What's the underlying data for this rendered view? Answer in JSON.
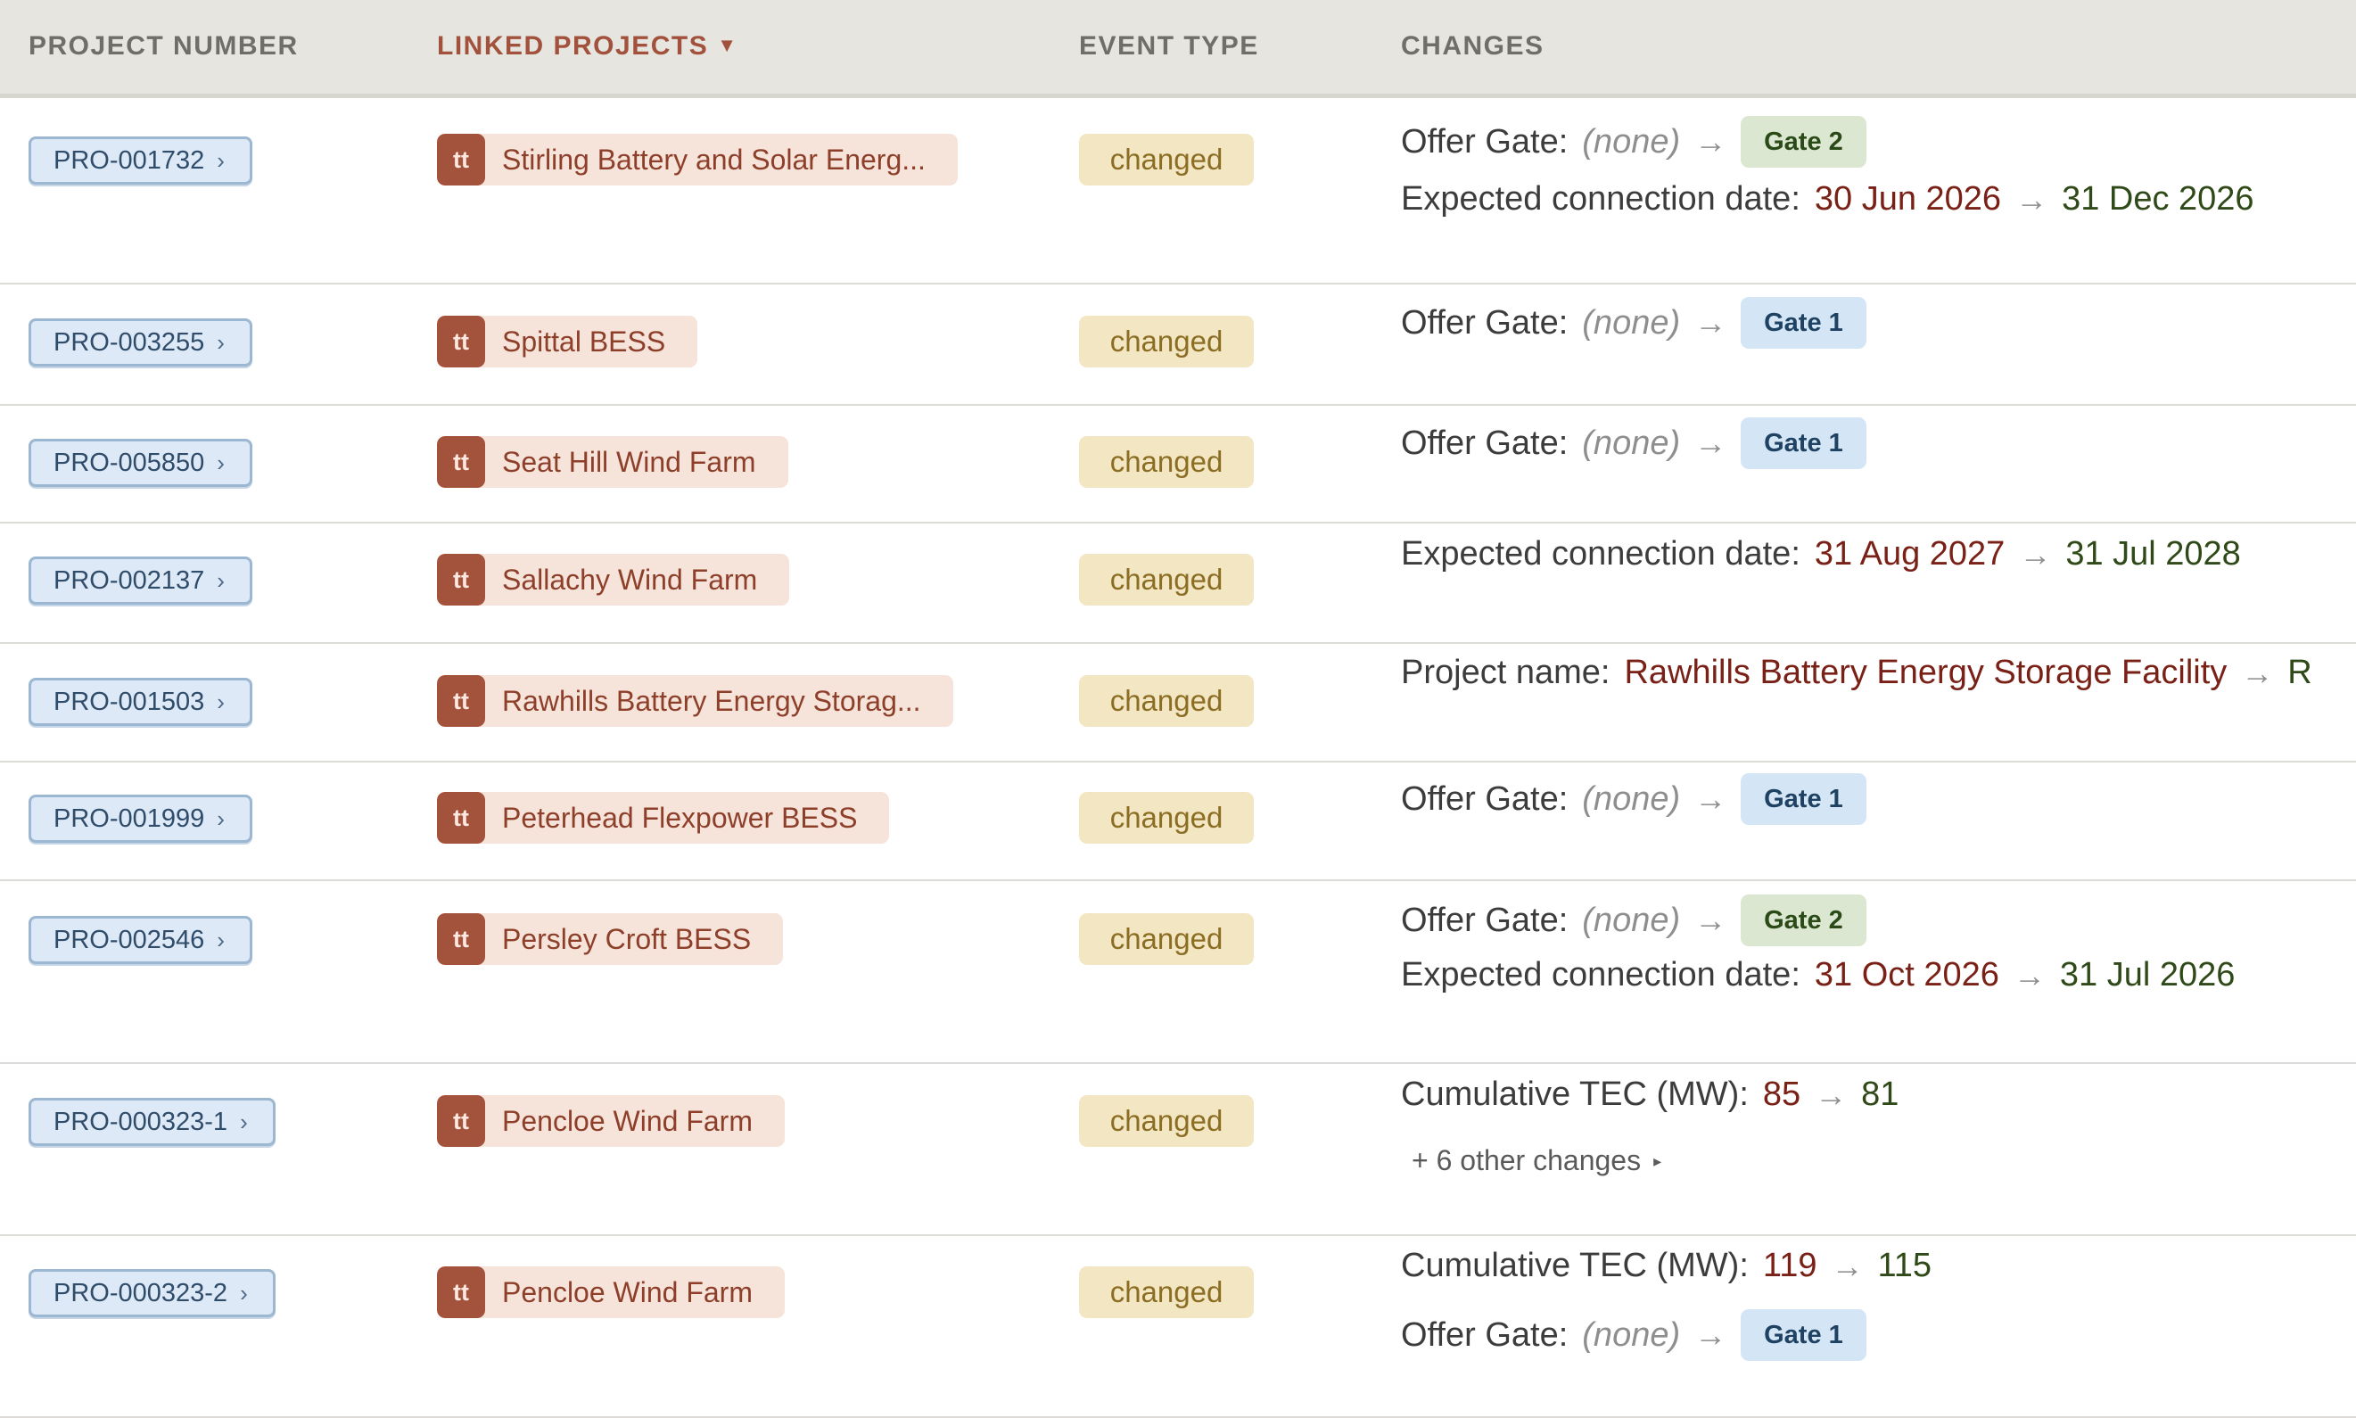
{
  "header": {
    "project_number": "PROJECT NUMBER",
    "linked_projects": "LINKED PROJECTS",
    "event_type": "EVENT TYPE",
    "changes": "CHANGES",
    "sort_indicator": "▼"
  },
  "icons": {
    "project_chevron": "chevron-right-icon",
    "arrow": "arrow-right-icon",
    "expand": "triangle-right-icon"
  },
  "colors": {
    "accent": "#a3523b",
    "gate1": "#d4e6f5",
    "gate2": "#dbe7d0",
    "event": "#f3e6c2",
    "project_pill": "#dde9f6"
  },
  "rows": [
    {
      "project_number": "PRO-001732",
      "avatar": "tt",
      "linked_project": "Stirling Battery and Solar Energ...",
      "event": "changed",
      "changes": [
        {
          "label": "Offer Gate:",
          "old": "(none)",
          "new": "Gate 2"
        },
        {
          "label": "Expected connection date:",
          "old": "30 Jun 2026",
          "new": "31 Dec 2026"
        }
      ]
    },
    {
      "project_number": "PRO-003255",
      "avatar": "tt",
      "linked_project": "Spittal BESS",
      "event": "changed",
      "changes": [
        {
          "label": "Offer Gate:",
          "old": "(none)",
          "new": "Gate 1"
        }
      ]
    },
    {
      "project_number": "PRO-005850",
      "avatar": "tt",
      "linked_project": "Seat Hill Wind Farm",
      "event": "changed",
      "changes": [
        {
          "label": "Offer Gate:",
          "old": "(none)",
          "new": "Gate 1"
        }
      ]
    },
    {
      "project_number": "PRO-002137",
      "avatar": "tt",
      "linked_project": "Sallachy Wind Farm",
      "event": "changed",
      "changes": [
        {
          "label": "Expected connection date:",
          "old": "31 Aug 2027",
          "new": "31 Jul 2028"
        }
      ]
    },
    {
      "project_number": "PRO-001503",
      "avatar": "tt",
      "linked_project": "Rawhills Battery Energy Storag...",
      "event": "changed",
      "changes": [
        {
          "label": "Project name:",
          "old": "Rawhills Battery Energy Storage Facility",
          "new": "R"
        }
      ]
    },
    {
      "project_number": "PRO-001999",
      "avatar": "tt",
      "linked_project": "Peterhead Flexpower BESS",
      "event": "changed",
      "changes": [
        {
          "label": "Offer Gate:",
          "old": "(none)",
          "new": "Gate 1"
        }
      ]
    },
    {
      "project_number": "PRO-002546",
      "avatar": "tt",
      "linked_project": "Persley Croft BESS",
      "event": "changed",
      "changes": [
        {
          "label": "Offer Gate:",
          "old": "(none)",
          "new": "Gate 2"
        },
        {
          "label": "Expected connection date:",
          "old": "31 Oct 2026",
          "new": "31 Jul 2026"
        }
      ]
    },
    {
      "project_number": "PRO-000323-1",
      "avatar": "tt",
      "linked_project": "Pencloe Wind Farm",
      "event": "changed",
      "changes": [
        {
          "label": "Cumulative TEC (MW):",
          "old": "85",
          "new": "81"
        }
      ],
      "more": "+ 6 other changes"
    },
    {
      "project_number": "PRO-000323-2",
      "avatar": "tt",
      "linked_project": "Pencloe Wind Farm",
      "event": "changed",
      "changes": [
        {
          "label": "Cumulative TEC (MW):",
          "old": "119",
          "new": "115"
        },
        {
          "label": "Offer Gate:",
          "old": "(none)",
          "new": "Gate 1"
        }
      ]
    }
  ]
}
